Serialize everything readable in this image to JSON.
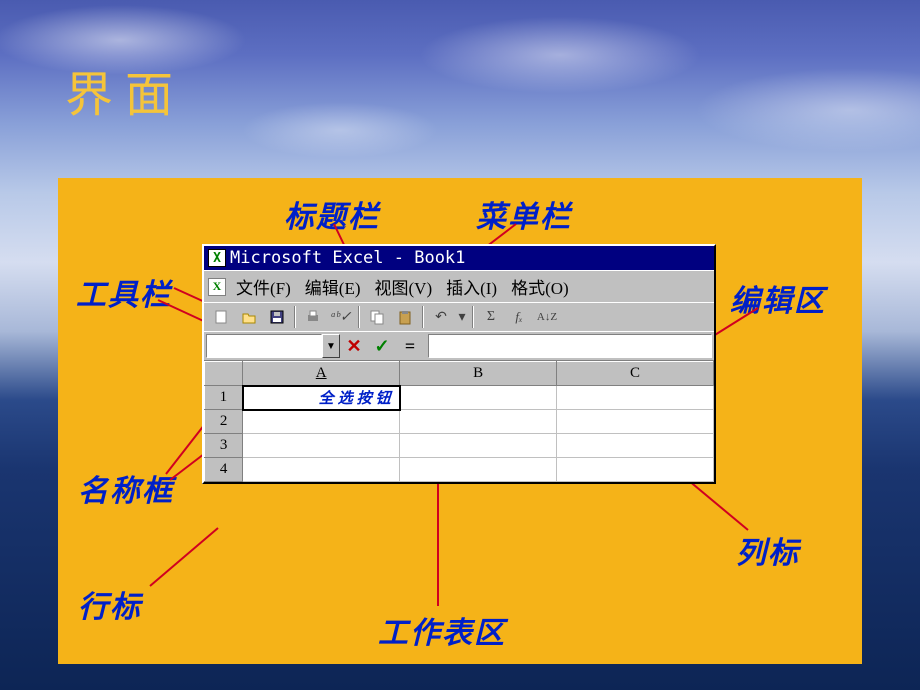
{
  "slide": {
    "title": "界面"
  },
  "annotations": {
    "titlebar": "标题栏",
    "menubar": "菜单栏",
    "toolbar": "工具栏",
    "editarea": "编辑区",
    "namebox": "名称框",
    "selectall": "全选按钮",
    "colheader": "列标",
    "rowheader": "行标",
    "worksheet": "工作表区"
  },
  "excel": {
    "title": "Microsoft Excel - Book1",
    "menus": {
      "file": "文件(F)",
      "edit": "编辑(E)",
      "view": "视图(V)",
      "insert": "插入(I)",
      "format": "格式(O)"
    },
    "columns": [
      "A",
      "B",
      "C"
    ],
    "rows": [
      "1",
      "2",
      "3",
      "4"
    ],
    "cell_a1": "全选按钮"
  }
}
